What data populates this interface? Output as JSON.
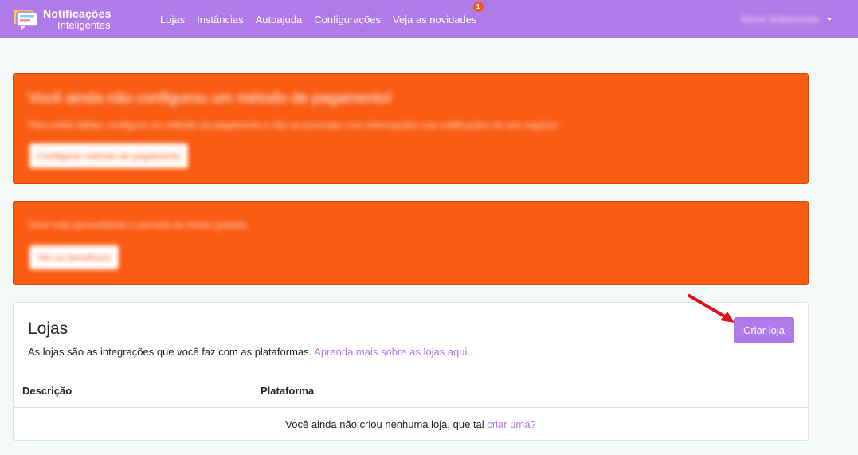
{
  "brand": {
    "name_line1": "Notificações",
    "name_line2": "Inteligentes",
    "accent_color": "#b07ae8"
  },
  "nav": {
    "items": [
      {
        "label": "Lojas"
      },
      {
        "label": "Instâncias"
      },
      {
        "label": "Autoajuda"
      },
      {
        "label": "Configurações"
      },
      {
        "label": "Veja as novidades",
        "badge": "1"
      }
    ],
    "user": {
      "name": "Nome Sobrenome",
      "icon": "chevron-down-icon"
    }
  },
  "alerts": [
    {
      "title": "Você ainda não configurou um método de pagamento!",
      "text": "Para evitar falhas, configure um método de pagamento e não se preocupe com interrupções nas notificações do seu negócio.",
      "button": "Configurar método de pagamento",
      "color": "#fa5c14"
    },
    {
      "text": "Você está aproveitando o período de testes gratuito",
      "button": "Ver os benefícios",
      "color": "#fa5c14"
    }
  ],
  "stores": {
    "title": "Lojas",
    "subtitle": "As lojas são as integrações que você faz com as plataformas.",
    "subtitle_link": "Aprenda mais sobre as lojas aqui.",
    "create_button": "Criar loja",
    "columns": [
      "Descrição",
      "Plataforma"
    ],
    "empty_text": "Você ainda não criou nenhuma loja, que tal",
    "empty_link": "criar uma?"
  }
}
